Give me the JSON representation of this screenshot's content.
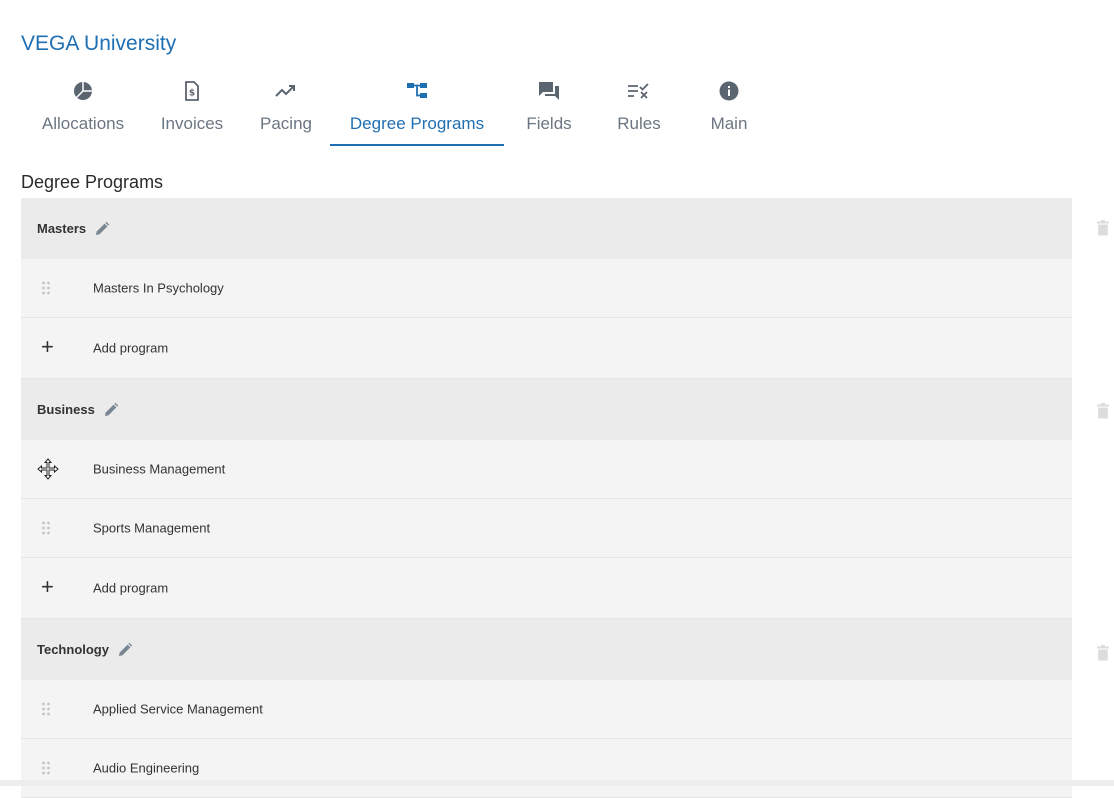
{
  "app": {
    "title": "VEGA University"
  },
  "tabs": [
    {
      "label": "Allocations",
      "icon": "pie-chart-icon"
    },
    {
      "label": "Invoices",
      "icon": "invoice-icon"
    },
    {
      "label": "Pacing",
      "icon": "trending-up-icon"
    },
    {
      "label": "Degree Programs",
      "icon": "hierarchy-icon",
      "active": true
    },
    {
      "label": "Fields",
      "icon": "forum-icon"
    },
    {
      "label": "Rules",
      "icon": "rules-icon"
    },
    {
      "label": "Main",
      "icon": "info-icon"
    }
  ],
  "section": {
    "title": "Degree Programs"
  },
  "groups": [
    {
      "name": "Masters",
      "programs": [
        "Masters In Psychology"
      ],
      "add_label": "Add program"
    },
    {
      "name": "Business",
      "programs": [
        "Business Management",
        "Sports Management"
      ],
      "add_label": "Add program"
    },
    {
      "name": "Technology",
      "programs": [
        "Applied Service Management",
        "Audio Engineering"
      ]
    }
  ],
  "colors": {
    "accent": "#1f6fb2",
    "header_bg": "#ebebeb",
    "row_bg": "#f4f4f4",
    "icon": "#5b6570"
  }
}
